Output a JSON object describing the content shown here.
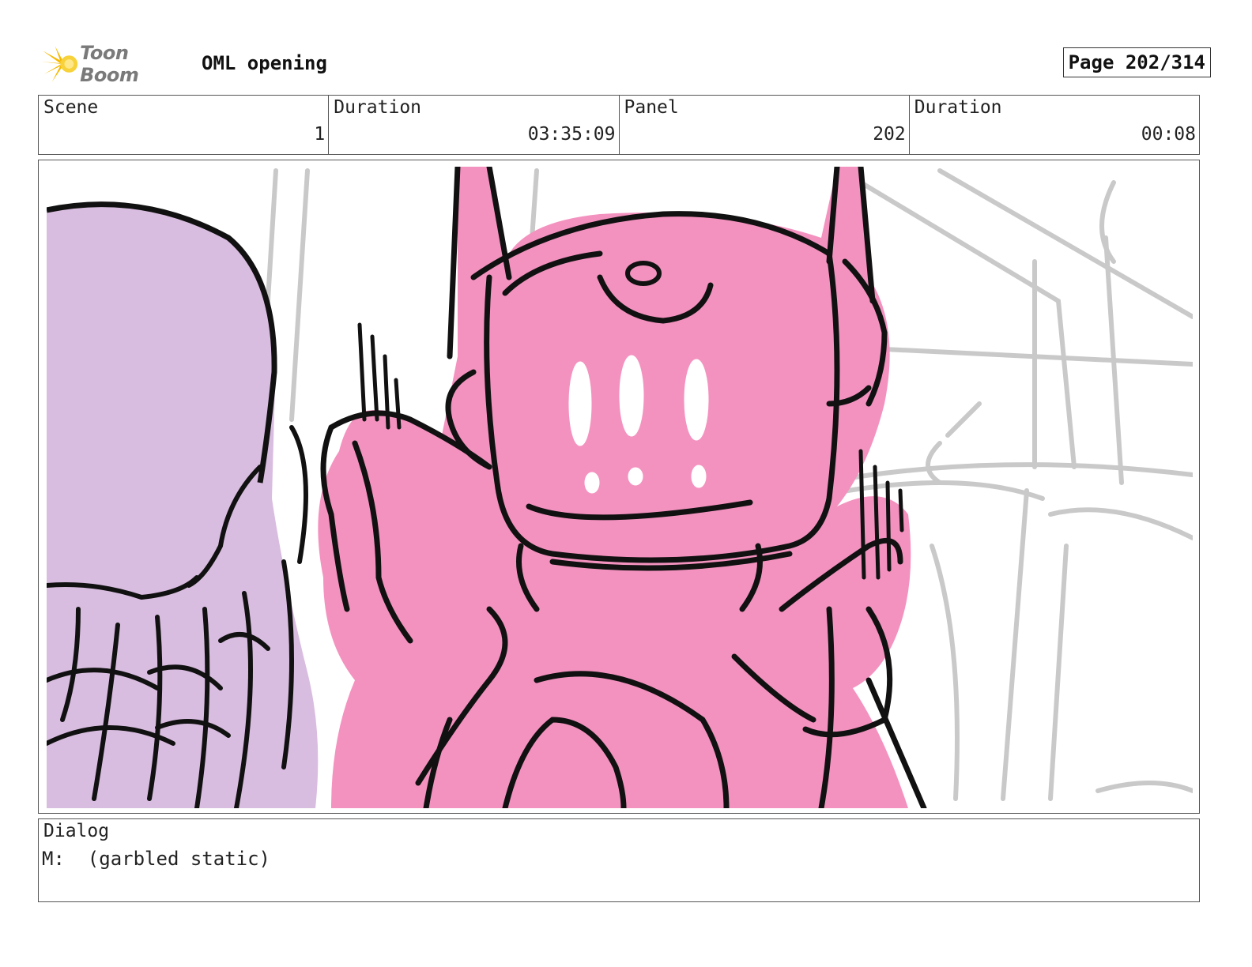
{
  "header": {
    "logo_text": "Toon Boom",
    "project_title": "OML opening",
    "page_label": "Page 202/314"
  },
  "info": {
    "scene_label": "Scene",
    "scene_value": "1",
    "duration_label": "Duration",
    "duration_value": "03:35:09",
    "panel_label": "Panel",
    "panel_value": "202",
    "panel_duration_label": "Duration",
    "panel_duration_value": "00:08"
  },
  "dialog": {
    "label": "Dialog",
    "text": "M:  (garbled static)"
  },
  "colors": {
    "robot_pink": "#f492bf",
    "creature_lilac": "#d9bde0",
    "sketch_gray": "#c8c8c8",
    "logo_yellow": "#f5c400"
  },
  "icons": {
    "logo": "toon-boom-star-icon"
  }
}
